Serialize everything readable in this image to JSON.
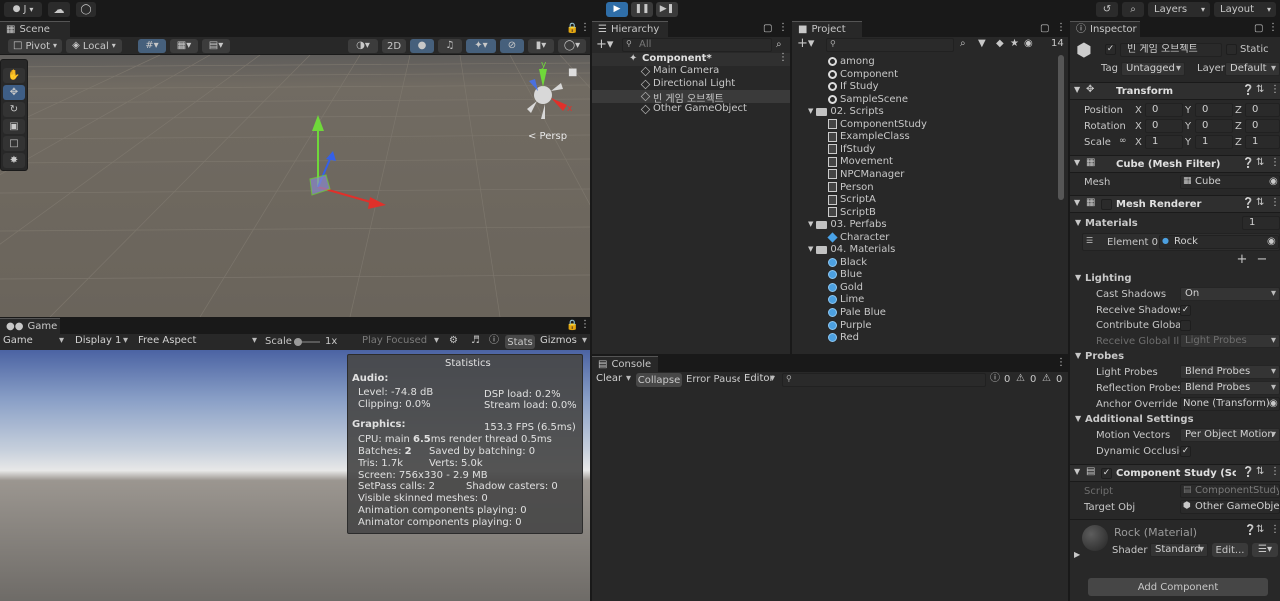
{
  "toolbar": {
    "account": "J",
    "layers": "Layers",
    "layout": "Layout"
  },
  "scene": {
    "tab": "Scene",
    "pivot": "Pivot",
    "local": "Local",
    "mode_2d": "2D",
    "persp": "< Persp"
  },
  "game": {
    "tab": "Game",
    "display_mode": "Game",
    "display": "Display 1",
    "aspect": "Free Aspect",
    "scale_label": "Scale",
    "scale_value": "1x",
    "play_focused": "Play Focused",
    "stats": "Stats",
    "gizmos": "Gizmos"
  },
  "statistics": {
    "title": "Statistics",
    "audio_heading": "Audio:",
    "level": "Level: -74.8 dB",
    "dsp": "DSP load: 0.2%",
    "clipping": "Clipping: 0.0%",
    "stream": "Stream load: 0.0%",
    "graphics_heading": "Graphics:",
    "fps": "153.3 FPS (6.5ms)",
    "cpu_prefix": "CPU: main ",
    "cpu_main": "6.5",
    "cpu_suffix": "ms  render thread 0.5ms",
    "batches_prefix": "Batches: ",
    "batches": "2",
    "saved_batching": "Saved by batching: 0",
    "tris": "Tris: 1.7k",
    "verts": "Verts: 5.0k",
    "screen": "Screen: 756x330 - 2.9 MB",
    "setpass": "SetPass calls: 2",
    "shadow_casters": "Shadow casters: 0",
    "visible_skinned": "Visible skinned meshes: 0",
    "animation_components": "Animation components playing: 0",
    "animator_components": "Animator components playing: 0"
  },
  "hierarchy": {
    "tab": "Hierarchy",
    "search_placeholder": "All",
    "scene_name": "Component*",
    "items": [
      "Main Camera",
      "Directional Light",
      "빈 게임 오브젝트",
      "Other GameObject"
    ]
  },
  "project": {
    "tab": "Project",
    "count": "14",
    "items": [
      {
        "label": "among",
        "icon": "unity-icon",
        "indent": 0
      },
      {
        "label": "Component",
        "icon": "unity-icon",
        "indent": 0
      },
      {
        "label": "If Study",
        "icon": "unity-icon",
        "indent": 0
      },
      {
        "label": "SampleScene",
        "icon": "unity-icon",
        "indent": 0
      },
      {
        "label": "02. Scripts",
        "icon": "folder-icon",
        "indent": -1
      },
      {
        "label": "ComponentStudy",
        "icon": "script-icon",
        "indent": 1
      },
      {
        "label": "ExampleClass",
        "icon": "script-icon",
        "indent": 1
      },
      {
        "label": "IfStudy",
        "icon": "script-icon",
        "indent": 1
      },
      {
        "label": "Movement",
        "icon": "script-icon",
        "indent": 1
      },
      {
        "label": "NPCManager",
        "icon": "script-icon",
        "indent": 1
      },
      {
        "label": "Person",
        "icon": "script-icon",
        "indent": 1
      },
      {
        "label": "ScriptA",
        "icon": "script-icon",
        "indent": 1
      },
      {
        "label": "ScriptB",
        "icon": "script-icon",
        "indent": 1
      },
      {
        "label": "03. Perfabs",
        "icon": "folder-icon",
        "indent": -1
      },
      {
        "label": "Character",
        "icon": "prefab-icon",
        "indent": 1
      },
      {
        "label": "04. Materials",
        "icon": "folder-icon",
        "indent": -1
      },
      {
        "label": "Black",
        "icon": "material-icon",
        "indent": 1
      },
      {
        "label": "Blue",
        "icon": "material-icon",
        "indent": 1
      },
      {
        "label": "Gold",
        "icon": "material-icon",
        "indent": 1
      },
      {
        "label": "Lime",
        "icon": "material-icon",
        "indent": 1
      },
      {
        "label": "Pale Blue",
        "icon": "material-icon",
        "indent": 1
      },
      {
        "label": "Purple",
        "icon": "material-icon",
        "indent": 1
      },
      {
        "label": "Red",
        "icon": "material-icon",
        "indent": 1
      }
    ]
  },
  "console": {
    "tab": "Console",
    "clear": "Clear",
    "collapse": "Collapse",
    "error_pause": "Error Pause",
    "editor": "Editor",
    "count_info": "0",
    "count_warn": "0",
    "count_error": "0"
  },
  "inspector": {
    "tab": "Inspector",
    "object_name": "빈 게임 오브젝트",
    "static": "Static",
    "tag_label": "Tag",
    "tag_value": "Untagged",
    "layer_label": "Layer",
    "layer_value": "Default",
    "transform": {
      "title": "Transform",
      "position_label": "Position",
      "rotation_label": "Rotation",
      "scale_label": "Scale",
      "position": [
        "0",
        "0",
        "0"
      ],
      "rotation": [
        "0",
        "0",
        "0"
      ],
      "scale": [
        "1",
        "1",
        "1"
      ]
    },
    "mesh_filter": {
      "title": "Cube (Mesh Filter)",
      "mesh_label": "Mesh",
      "mesh_value": "Cube"
    },
    "mesh_renderer": {
      "title": "Mesh Renderer",
      "materials_label": "Materials",
      "materials_count": "1",
      "element0_label": "Element 0",
      "element0_value": "Rock",
      "lighting_label": "Lighting",
      "cast_shadows_label": "Cast Shadows",
      "cast_shadows_value": "On",
      "receive_shadows_label": "Receive Shadows",
      "contribute_gi_label": "Contribute Global I",
      "receive_gi_label": "Receive Global Illu",
      "receive_gi_value": "Light Probes",
      "probes_label": "Probes",
      "light_probes_label": "Light Probes",
      "light_probes_value": "Blend Probes",
      "reflection_probes_label": "Reflection Probes",
      "reflection_probes_value": "Blend Probes",
      "anchor_override_label": "Anchor Override",
      "anchor_override_value": "None (Transform)",
      "additional_label": "Additional Settings",
      "motion_vectors_label": "Motion Vectors",
      "motion_vectors_value": "Per Object Motion",
      "dynamic_occlusion_label": "Dynamic Occlusion"
    },
    "component_study": {
      "title": "Component Study (Script",
      "script_label": "Script",
      "script_value": "ComponentStudy",
      "target_label": "Target Obj",
      "target_value": "Other GameObje"
    },
    "material": {
      "title": "Rock (Material)",
      "shader_label": "Shader",
      "shader_value": "Standard",
      "edit": "Edit..."
    },
    "add_component": "Add Component"
  }
}
